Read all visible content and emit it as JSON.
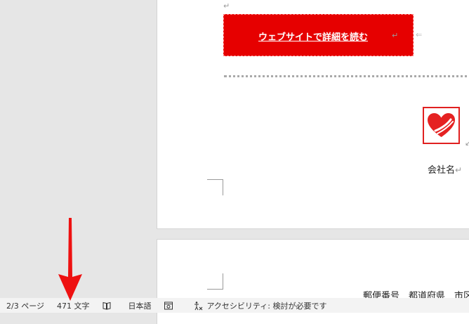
{
  "document": {
    "cta_text": "ウェブサイトで詳細を読む",
    "company_name": "会社名",
    "address_line": "郵便番号　都道府県　市区",
    "paragraph_mark": "↵",
    "brand_color": "#e60000"
  },
  "statusbar": {
    "page_info": "2/3 ページ",
    "word_count": "471 文字",
    "language": "日本語",
    "accessibility": "アクセシビリティ: 検討が必要です"
  },
  "annotation": {
    "arrow_color": "#ee1111"
  }
}
